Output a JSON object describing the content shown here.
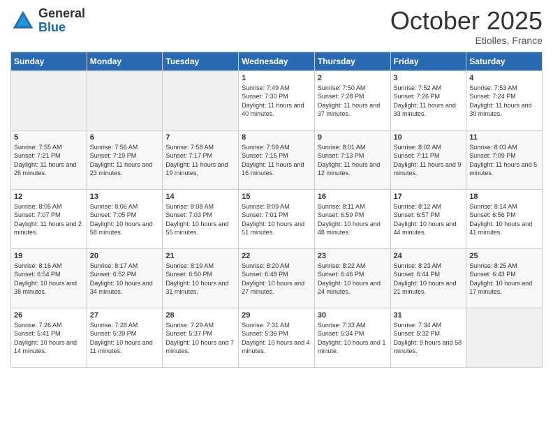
{
  "header": {
    "logo_general": "General",
    "logo_blue": "Blue",
    "month_title": "October 2025",
    "location": "Etiolles, France"
  },
  "days_of_week": [
    "Sunday",
    "Monday",
    "Tuesday",
    "Wednesday",
    "Thursday",
    "Friday",
    "Saturday"
  ],
  "weeks": [
    [
      {
        "day": "",
        "empty": true
      },
      {
        "day": "",
        "empty": true
      },
      {
        "day": "",
        "empty": true
      },
      {
        "day": "1",
        "sunrise": "7:49 AM",
        "sunset": "7:30 PM",
        "daylight": "11 hours and 40 minutes."
      },
      {
        "day": "2",
        "sunrise": "7:50 AM",
        "sunset": "7:28 PM",
        "daylight": "11 hours and 37 minutes."
      },
      {
        "day": "3",
        "sunrise": "7:52 AM",
        "sunset": "7:26 PM",
        "daylight": "11 hours and 33 minutes."
      },
      {
        "day": "4",
        "sunrise": "7:53 AM",
        "sunset": "7:24 PM",
        "daylight": "11 hours and 30 minutes."
      }
    ],
    [
      {
        "day": "5",
        "sunrise": "7:55 AM",
        "sunset": "7:21 PM",
        "daylight": "11 hours and 26 minutes."
      },
      {
        "day": "6",
        "sunrise": "7:56 AM",
        "sunset": "7:19 PM",
        "daylight": "11 hours and 23 minutes."
      },
      {
        "day": "7",
        "sunrise": "7:58 AM",
        "sunset": "7:17 PM",
        "daylight": "11 hours and 19 minutes."
      },
      {
        "day": "8",
        "sunrise": "7:59 AM",
        "sunset": "7:15 PM",
        "daylight": "11 hours and 16 minutes."
      },
      {
        "day": "9",
        "sunrise": "8:01 AM",
        "sunset": "7:13 PM",
        "daylight": "11 hours and 12 minutes."
      },
      {
        "day": "10",
        "sunrise": "8:02 AM",
        "sunset": "7:11 PM",
        "daylight": "11 hours and 9 minutes."
      },
      {
        "day": "11",
        "sunrise": "8:03 AM",
        "sunset": "7:09 PM",
        "daylight": "11 hours and 5 minutes."
      }
    ],
    [
      {
        "day": "12",
        "sunrise": "8:05 AM",
        "sunset": "7:07 PM",
        "daylight": "11 hours and 2 minutes."
      },
      {
        "day": "13",
        "sunrise": "8:06 AM",
        "sunset": "7:05 PM",
        "daylight": "10 hours and 58 minutes."
      },
      {
        "day": "14",
        "sunrise": "8:08 AM",
        "sunset": "7:03 PM",
        "daylight": "10 hours and 55 minutes."
      },
      {
        "day": "15",
        "sunrise": "8:09 AM",
        "sunset": "7:01 PM",
        "daylight": "10 hours and 51 minutes."
      },
      {
        "day": "16",
        "sunrise": "8:11 AM",
        "sunset": "6:59 PM",
        "daylight": "10 hours and 48 minutes."
      },
      {
        "day": "17",
        "sunrise": "8:12 AM",
        "sunset": "6:57 PM",
        "daylight": "10 hours and 44 minutes."
      },
      {
        "day": "18",
        "sunrise": "8:14 AM",
        "sunset": "6:56 PM",
        "daylight": "10 hours and 41 minutes."
      }
    ],
    [
      {
        "day": "19",
        "sunrise": "8:16 AM",
        "sunset": "6:54 PM",
        "daylight": "10 hours and 38 minutes."
      },
      {
        "day": "20",
        "sunrise": "8:17 AM",
        "sunset": "6:52 PM",
        "daylight": "10 hours and 34 minutes."
      },
      {
        "day": "21",
        "sunrise": "8:19 AM",
        "sunset": "6:50 PM",
        "daylight": "10 hours and 31 minutes."
      },
      {
        "day": "22",
        "sunrise": "8:20 AM",
        "sunset": "6:48 PM",
        "daylight": "10 hours and 27 minutes."
      },
      {
        "day": "23",
        "sunrise": "8:22 AM",
        "sunset": "6:46 PM",
        "daylight": "10 hours and 24 minutes."
      },
      {
        "day": "24",
        "sunrise": "8:23 AM",
        "sunset": "6:44 PM",
        "daylight": "10 hours and 21 minutes."
      },
      {
        "day": "25",
        "sunrise": "8:25 AM",
        "sunset": "6:43 PM",
        "daylight": "10 hours and 17 minutes."
      }
    ],
    [
      {
        "day": "26",
        "sunrise": "7:26 AM",
        "sunset": "5:41 PM",
        "daylight": "10 hours and 14 minutes."
      },
      {
        "day": "27",
        "sunrise": "7:28 AM",
        "sunset": "5:39 PM",
        "daylight": "10 hours and 11 minutes."
      },
      {
        "day": "28",
        "sunrise": "7:29 AM",
        "sunset": "5:37 PM",
        "daylight": "10 hours and 7 minutes."
      },
      {
        "day": "29",
        "sunrise": "7:31 AM",
        "sunset": "5:36 PM",
        "daylight": "10 hours and 4 minutes."
      },
      {
        "day": "30",
        "sunrise": "7:33 AM",
        "sunset": "5:34 PM",
        "daylight": "10 hours and 1 minute."
      },
      {
        "day": "31",
        "sunrise": "7:34 AM",
        "sunset": "5:32 PM",
        "daylight": "9 hours and 58 minutes."
      },
      {
        "day": "",
        "empty": true
      }
    ]
  ]
}
